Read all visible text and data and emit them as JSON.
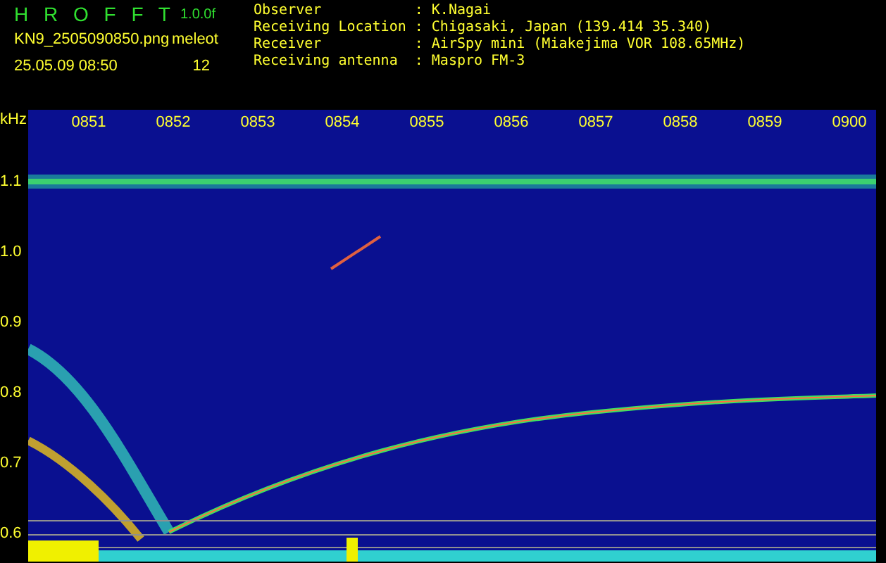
{
  "header": {
    "title": "H R O F F T",
    "version": "1.0.0f",
    "filename": "KN9_2505090850.png",
    "mode": "meleot",
    "datetime": "25.05.09 08:50",
    "count": "12"
  },
  "info": [
    {
      "label": "Observer",
      "separator": ":",
      "value": "K.Nagai"
    },
    {
      "label": "Receiving Location",
      "separator": ":",
      "value": "Chigasaki, Japan (139.414 35.340)"
    },
    {
      "label": "Receiver",
      "separator": ":",
      "value": "AirSpy mini (Miakejima VOR 108.65MHz)"
    },
    {
      "label": "Receiving antenna",
      "separator": ":",
      "value": "Maspro FM-3"
    }
  ],
  "spectrogram": {
    "unit": "kHz",
    "time_labels": [
      "0851",
      "0852",
      "0853",
      "0854",
      "0855",
      "0856",
      "0857",
      "0858",
      "0859",
      "0900"
    ],
    "freq_labels": [
      "1.1",
      "1.0",
      "0.9",
      "0.8",
      "0.7",
      "0.6"
    ]
  }
}
